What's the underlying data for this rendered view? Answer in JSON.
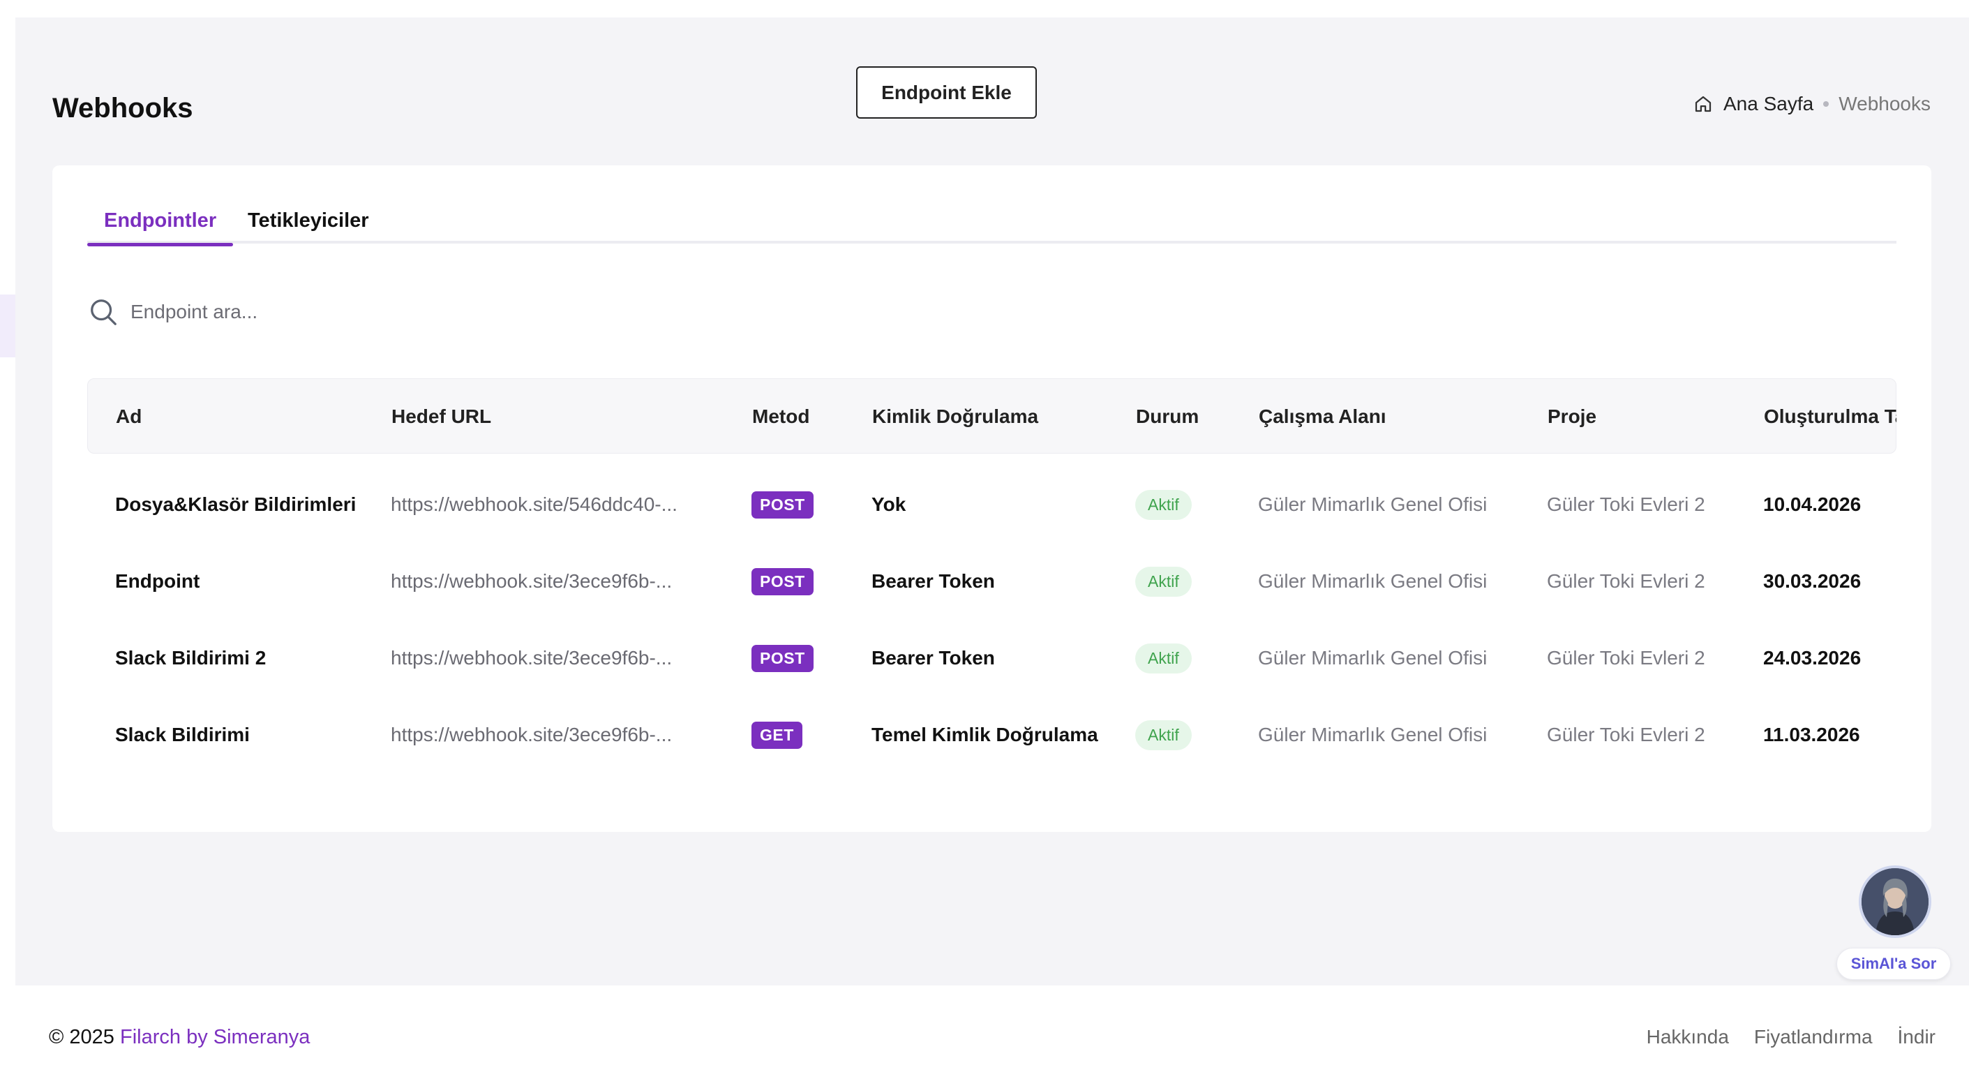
{
  "header": {
    "title": "Webhooks",
    "add_button": "Endpoint Ekle",
    "breadcrumb": {
      "home": "Ana Sayfa",
      "current": "Webhooks"
    }
  },
  "tabs": [
    {
      "label": "Endpointler",
      "active": true
    },
    {
      "label": "Tetikleyiciler",
      "active": false
    }
  ],
  "search": {
    "placeholder": "Endpoint ara..."
  },
  "table": {
    "columns": [
      "Ad",
      "Hedef URL",
      "Metod",
      "Kimlik Doğrulama",
      "Durum",
      "Çalışma Alanı",
      "Proje",
      "Oluşturulma Tar"
    ],
    "rows": [
      {
        "name": "Dosya&Klasör Bildirimleri",
        "url": "https://webhook.site/546ddc40-...",
        "method": "POST",
        "auth": "Yok",
        "status": "Aktif",
        "workspace": "Güler Mimarlık Genel Ofisi",
        "project": "Güler Toki Evleri 2",
        "created": "10.04.2026"
      },
      {
        "name": "Endpoint",
        "url": "https://webhook.site/3ece9f6b-...",
        "method": "POST",
        "auth": "Bearer Token",
        "status": "Aktif",
        "workspace": "Güler Mimarlık Genel Ofisi",
        "project": "Güler Toki Evleri 2",
        "created": "30.03.2026"
      },
      {
        "name": "Slack Bildirimi 2",
        "url": "https://webhook.site/3ece9f6b-...",
        "method": "POST",
        "auth": "Bearer Token",
        "status": "Aktif",
        "workspace": "Güler Mimarlık Genel Ofisi",
        "project": "Güler Toki Evleri 2",
        "created": "24.03.2026"
      },
      {
        "name": "Slack Bildirimi",
        "url": "https://webhook.site/3ece9f6b-...",
        "method": "GET",
        "auth": "Temel Kimlik Doğrulama",
        "status": "Aktif",
        "workspace": "Güler Mimarlık Genel Ofisi",
        "project": "Güler Toki Evleri 2",
        "created": "11.03.2026"
      }
    ]
  },
  "assistant": {
    "label": "SimAI'a Sor"
  },
  "footer": {
    "copyright": "© 2025",
    "brand": "Filarch by Simeranya",
    "links": [
      "Hakkında",
      "Fiyatlandırma",
      "İndir"
    ]
  },
  "colors": {
    "accent": "#7b2fbf",
    "status_bg": "#e6f6e9",
    "status_text": "#3fa34d",
    "assistant_text": "#5a55d6"
  }
}
